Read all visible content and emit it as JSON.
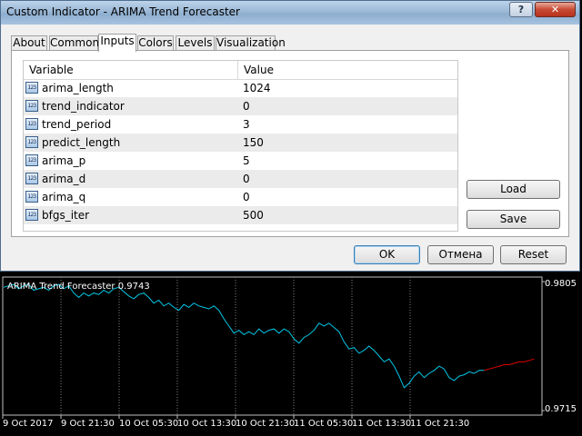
{
  "window": {
    "title": "Custom Indicator - ARIMA Trend Forecaster",
    "help_label": "?",
    "close_label": "✕"
  },
  "tabs": [
    {
      "label": "About"
    },
    {
      "label": "Common"
    },
    {
      "label": "Inputs"
    },
    {
      "label": "Colors"
    },
    {
      "label": "Levels"
    },
    {
      "label": "Visualization"
    }
  ],
  "active_tab": "Inputs",
  "params": {
    "header": {
      "name": "Variable",
      "value": "Value"
    },
    "icon_text": "123",
    "rows": [
      {
        "name": "arima_length",
        "value": "1024"
      },
      {
        "name": "trend_indicator",
        "value": "0"
      },
      {
        "name": "trend_period",
        "value": "3"
      },
      {
        "name": "predict_length",
        "value": "150"
      },
      {
        "name": "arima_p",
        "value": "5"
      },
      {
        "name": "arima_d",
        "value": "0"
      },
      {
        "name": "arima_q",
        "value": "0"
      },
      {
        "name": "bfgs_iter",
        "value": "500"
      }
    ]
  },
  "side_buttons": {
    "load": "Load",
    "save": "Save"
  },
  "footer_buttons": {
    "ok": "OK",
    "cancel": "Отмена",
    "reset": "Reset"
  },
  "chart": {
    "indicator_label": "ARIMA Trend Forecaster 0.9743",
    "price_top": "0.9805",
    "price_bottom": "0.9715",
    "time_labels": [
      "9 Oct 2017",
      "9 Oct 21:30",
      "10 Oct 05:30",
      "10 Oct 13:30",
      "10 Oct 21:30",
      "11 Oct 05:30",
      "11 Oct 13:30",
      "11 Oct 21:30"
    ],
    "colors": {
      "history": "#00c8e8",
      "forecast": "#e00000",
      "grid": "#808080"
    }
  },
  "chart_data": {
    "type": "line",
    "ylim": [
      0.9715,
      0.9805
    ],
    "series": [
      {
        "values": [
          0.9801,
          0.9802,
          0.9803,
          0.98,
          0.9802,
          0.9803,
          0.9799,
          0.98,
          0.9801,
          0.9799,
          0.9802,
          0.9803,
          0.98,
          0.9802,
          0.9797,
          0.9794,
          0.9797,
          0.9795,
          0.9797,
          0.9796,
          0.9799,
          0.9797,
          0.98,
          0.9801,
          0.9798,
          0.9795,
          0.9793,
          0.9796,
          0.9797,
          0.9794,
          0.979,
          0.9792,
          0.9788,
          0.979,
          0.9787,
          0.9785,
          0.9789,
          0.9787,
          0.979,
          0.9788,
          0.9787,
          0.9786,
          0.9788,
          0.9785,
          0.9779,
          0.9774,
          0.9769,
          0.9771,
          0.9768,
          0.977,
          0.9768,
          0.9772,
          0.9769,
          0.9771,
          0.9772,
          0.9769,
          0.9772,
          0.977,
          0.9765,
          0.9762,
          0.9766,
          0.9768,
          0.9771,
          0.9776,
          0.9774,
          0.9776,
          0.9773,
          0.977,
          0.9763,
          0.9758,
          0.9759,
          0.9755,
          0.9757,
          0.976,
          0.9757,
          0.9753,
          0.9749,
          0.9751,
          0.9746,
          0.9739,
          0.9731,
          0.9734,
          0.9739,
          0.9742,
          0.9738,
          0.9741,
          0.9743,
          0.9746,
          0.9744,
          0.9738,
          0.9736,
          0.9739,
          0.974,
          0.9742,
          0.9741,
          0.9743,
          0.9743
        ]
      },
      {
        "values": [
          0.9743,
          0.9744,
          0.9745,
          0.9746,
          0.9747,
          0.9747,
          0.9748,
          0.9749,
          0.9749,
          0.975,
          0.9751
        ]
      }
    ]
  }
}
